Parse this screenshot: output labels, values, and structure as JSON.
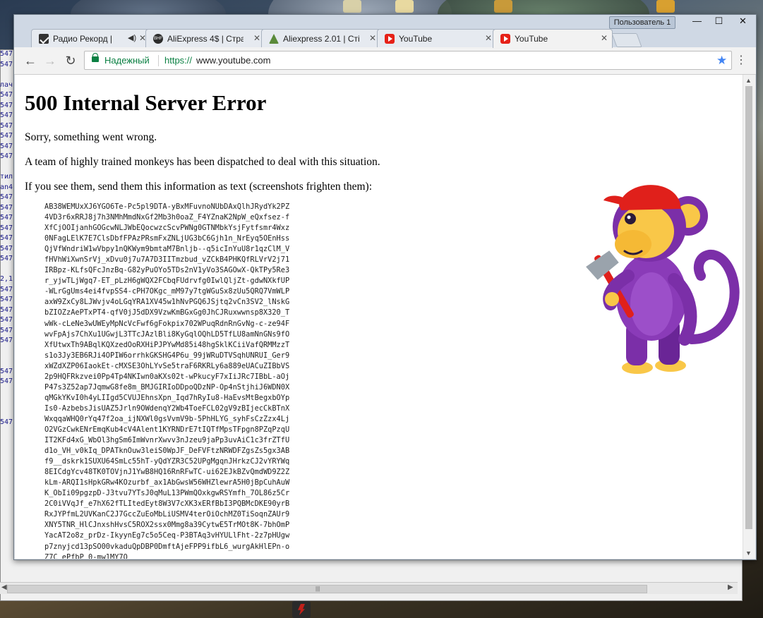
{
  "browser": {
    "profile_label": "Пользователь 1",
    "tabs": [
      {
        "title": "Радио Рекорд |",
        "favicon": "radio-record-icon",
        "extra": "◀)",
        "active": false
      },
      {
        "title": "AliExpress 4$ | Стра",
        "favicon": "aliexpress-icon",
        "active": false
      },
      {
        "title": "Aliexpress 2.01 | Сті",
        "favicon": "aliexpress-forum-icon",
        "active": false
      },
      {
        "title": "YouTube",
        "favicon": "youtube-icon",
        "active": false
      },
      {
        "title": "YouTube",
        "favicon": "youtube-icon",
        "active": true
      }
    ],
    "secure_label": "Надежный",
    "url_scheme": "https://",
    "url_host": "www.youtube.com"
  },
  "page": {
    "heading": "500 Internal Server Error",
    "line1": "Sorry, something went wrong.",
    "line2": "A team of highly trained monkeys has been dispatched to deal with this situation.",
    "line3": "If you see them, send them this information as text (screenshots frighten them):",
    "debug_text": "AB38WEMUxXJ6YGO6Te-Pc5pl9DTA-yBxMFuvnoNUbDAxQlhJRydYk2PZ\n4VD3r6xRRJ8j7h3NMhMmdNxGf2Mb3h0oaZ_F4YZnaK2NpW_eQxfsez-f\nXfCjOOIjanhGOGcwNLJWbEQocwzcScvPWNg0GTNMbkYsjFytfsmr4Wxz\n0NFagLElK7E7ClsDbfFPAzPRsmFxZNLjUG3bC6Gjh1n_NrEyq5OEnHss\nQjVfWndriW1wVbpy1nQKWym9bmtaM7Bnljb--q5icInYuU8r1qzClM_V\nfHVhWiXwnSrVj_xDvu0j7u7A7D3IITmzbud_vZCkB4PHKQfRLVrV2j71\nIRBpz-KLfsQFcJnzBq-G82yPuOYo5TDs2nV1yVo3SAGOwX-QkTPy5Re3\nr_yjwTLjWgq7-ET_pLzH6gWQX2FCbqFUdrvfg0IwlQljZt-gdwNXkfUP\n-WLrGgUms4ei4fvpSS4-cPH7OKgc_mM97y7tgWGuSx8zUu5QRQ7VmWLP\naxW9ZxCy8LJWvjv4oLGqYRA1XV45w1hNvPGQ6JSjtq2vCn3SV2_lNskG\nbZIOZzAePTxPT4-qfV0jJ5dDX9VzwKmBGxGg0JhCJRuxwwnsp8X320_T\nwWk-cLeNe3wUWEyMpNcVcFwf6gFokpix702WPuqRdnRnGvNg-c-ze94F\nwvFpAjs7ChXu1UGwjL3TTcJAzlBli8KyGqlOQhLD5TfLU8amNnGNs9fO\nXfUtwxTh9ABqlKQXzedOoRXHiPJPYwMd85i48hgSklKCiiVafQRMMzzT\ns1o3Jy3EB6RJi4OPIW6orrhkGKSHG4P6u_99jWRuDTVSqhUNRUI_Ger9\nxWZdXZP06IaokEt-cMXSE3OhLYvSe5traF6RKRLy6a889eUACuZIBbVS\n2p9HQFRkzvei0Pp4Tp4NKIwn0aKXs02t-wPkucyF7xIiJRc7IBbL-aOj\nP47s3Z52ap7JqmwG8fe8m_BMJGIRIoDDpoQDzNP-Op4nStjhiJ6WDN0X\nqMGkYKvI0h4yLIIgd5CVUJEhnsXpn_Iqd7hRyIu8-HaEvsMtBegxbOYp\nIs0-AzbebsJisUAZ5Jrln9OWdenqY2Wb4ToeFCL02gV9zBIjecCkBTnX\nWxqqaWHQ0rYq47f2oa_ijNXWl0gsVvmV9b-5PhHLYG_syhFsCzZzx4Lj\nO2VGzCwkENrEmqKub4cV4Alent1KYRNDrE7tIQTfMpsTFpgn8PZqPzqU\nIT2KFd4xG_WbOl3hgSm6ImWvnrXwvv3nJzeu9jaPp3uvAiC1c3frZTfU\nd1o_VH_v0kIq_DPATknOuw3leiS0WpJF_DeFVFtzNRWDFZgsZs5gx3AB\nf9__dskrk1SUXU64SmLc55hT-yQdYZR3C52UPgMgqnJHrkzCJ2vYRYWq\n8EICdgYcv48TK0TOVjnJ1YwB8HQ16RnRFwTC-ui62EJkBZvQmdWD9Z2Z\nkLm-ARQI1sHpkGRw4KOzurbf_ax1AbGwsW56WHZlewrA5H0jBpCuhAuW\nK_ObIi09pgzpD-J3tvu7YTsJ0qMuL13PWmQOxkgwRSYmfh_7OL86z5Cr\n2C0iVVqJf_e7hX62fTLItedEyt8W3V7cXK3xERfBbI3PQBMcDKE90yrB\nRxJYPfmL2UVKanC2J7GccZuEoMbLiUSMV4terOiOchMZ0TiSoqnZAUr9\nXNY5TNR_HlCJnxshHvsC5ROX2ssx0Mmg8a39CytwE5TrMOt8K-7bhOmP\nYacAT2o8z_prDz-IkyynEg7c5o5Ceq-P3BTAq3vHYULlFht-2z7pHUgw\np7znyjcd13pSO00vkaduQpDBP0DmftAjeFPP9ifbL6_wurgAkHlEPn-o\nZ7C_ePfbP_0-mw1MY7O"
  },
  "background_window": {
    "left_col_lines": [
      "547",
      "547",
      "",
      "лач",
      "547",
      "547",
      "547",
      "547",
      "547",
      "547",
      "547",
      "",
      "тил",
      "an4",
      "547",
      "547",
      "547",
      "547",
      "547",
      "547",
      "547",
      "",
      "2,1",
      "547",
      "547",
      "547",
      "547",
      "547",
      "547",
      "",
      "",
      "547",
      "547",
      "",
      "",
      "",
      "547"
    ]
  },
  "colors": {
    "secure_green": "#0b8043",
    "star_blue": "#4285f4",
    "youtube_red": "#e62117",
    "monkey_purple": "#7b2fa8",
    "monkey_face": "#f9c748",
    "cap_red": "#e0201b"
  }
}
